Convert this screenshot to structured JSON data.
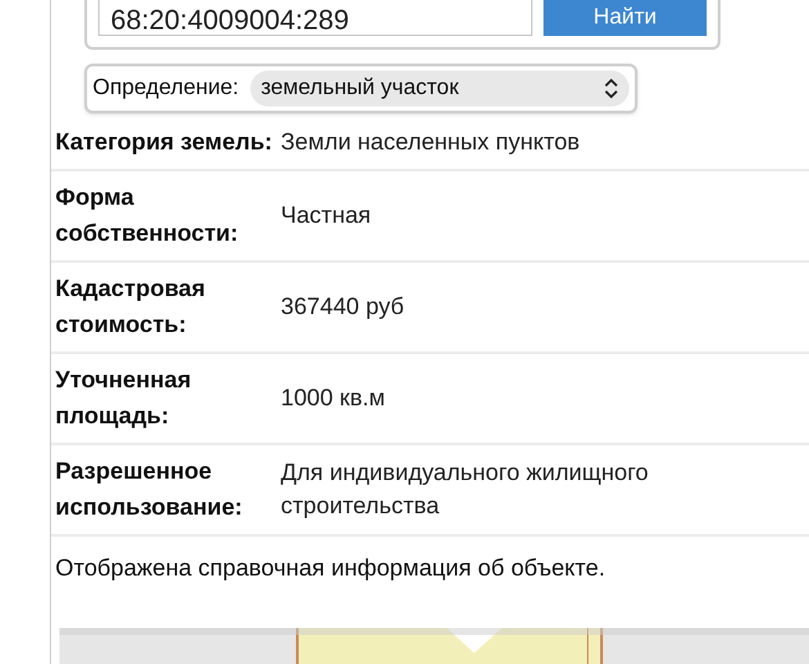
{
  "search": {
    "value": "68:20:4009004:289",
    "button": "Найти"
  },
  "definition": {
    "label": "Определение:",
    "value": "земельный участок"
  },
  "rows": [
    {
      "label": "Категория земель:",
      "value": "Земли населенных пунктов"
    },
    {
      "label": "Форма собственности:",
      "value": "Частная"
    },
    {
      "label": "Кадастровая стоимость:",
      "value": "367440 руб"
    },
    {
      "label": "Уточненная площадь:",
      "value": "1000 кв.м"
    },
    {
      "label": "Разрешенное использование:",
      "value": "Для индивидуального жилищного строительства"
    }
  ],
  "note": "Отображена справочная информация об объекте."
}
